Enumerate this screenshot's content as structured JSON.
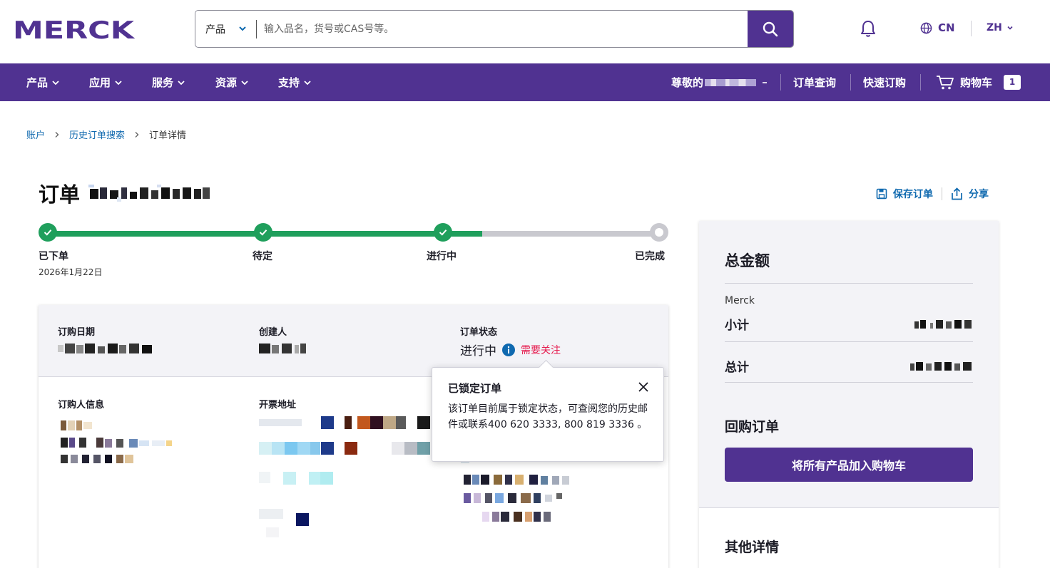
{
  "header": {
    "logo_text": "MERCK",
    "search": {
      "category": "产品",
      "placeholder": "输入品名，货号或CAS号等。"
    },
    "country": "CN",
    "language": "ZH"
  },
  "nav": {
    "items": [
      "产品",
      "应用",
      "服务",
      "资源",
      "支持"
    ],
    "greeting": "尊敬的",
    "order_lookup": "订单查询",
    "quick_order": "快速订购",
    "cart_label": "购物车",
    "cart_count": "1"
  },
  "breadcrumb": [
    "账户",
    "历史订单搜索",
    "订单详情"
  ],
  "page": {
    "title": "订单",
    "save_order": "保存订单",
    "share": "分享"
  },
  "stepper": {
    "steps": [
      {
        "label": "已下单",
        "status": "done",
        "date": "2026年1月22日"
      },
      {
        "label": "待定",
        "status": "done"
      },
      {
        "label": "进行中",
        "status": "done"
      },
      {
        "label": "已完成",
        "status": "pending"
      }
    ],
    "progress_fraction": 0.71
  },
  "details": {
    "order_date_label": "订购日期",
    "creator_label": "创建人",
    "status_label": "订单状态",
    "status_value": "进行中",
    "status_flag": "需要关注",
    "buyer_info_label": "订购人信息",
    "billing_address_label": "开票地址"
  },
  "popover": {
    "title": "已锁定订单",
    "body": "该订单目前属于锁定状态，可查阅您的历史邮件或联系400 620 3333, 800 819 3336 。"
  },
  "summary": {
    "title": "总金额",
    "vendor": "Merck",
    "subtotal_label": "小计",
    "total_label": "总计",
    "reorder_title": "回购订单",
    "add_all_button": "将所有产品加入购物车",
    "other_details": "其他详情"
  },
  "colors": {
    "brand_purple": "#503291",
    "success_green": "#1f9f5c",
    "link_blue": "#0f69af",
    "attention_red": "#e61e50"
  }
}
